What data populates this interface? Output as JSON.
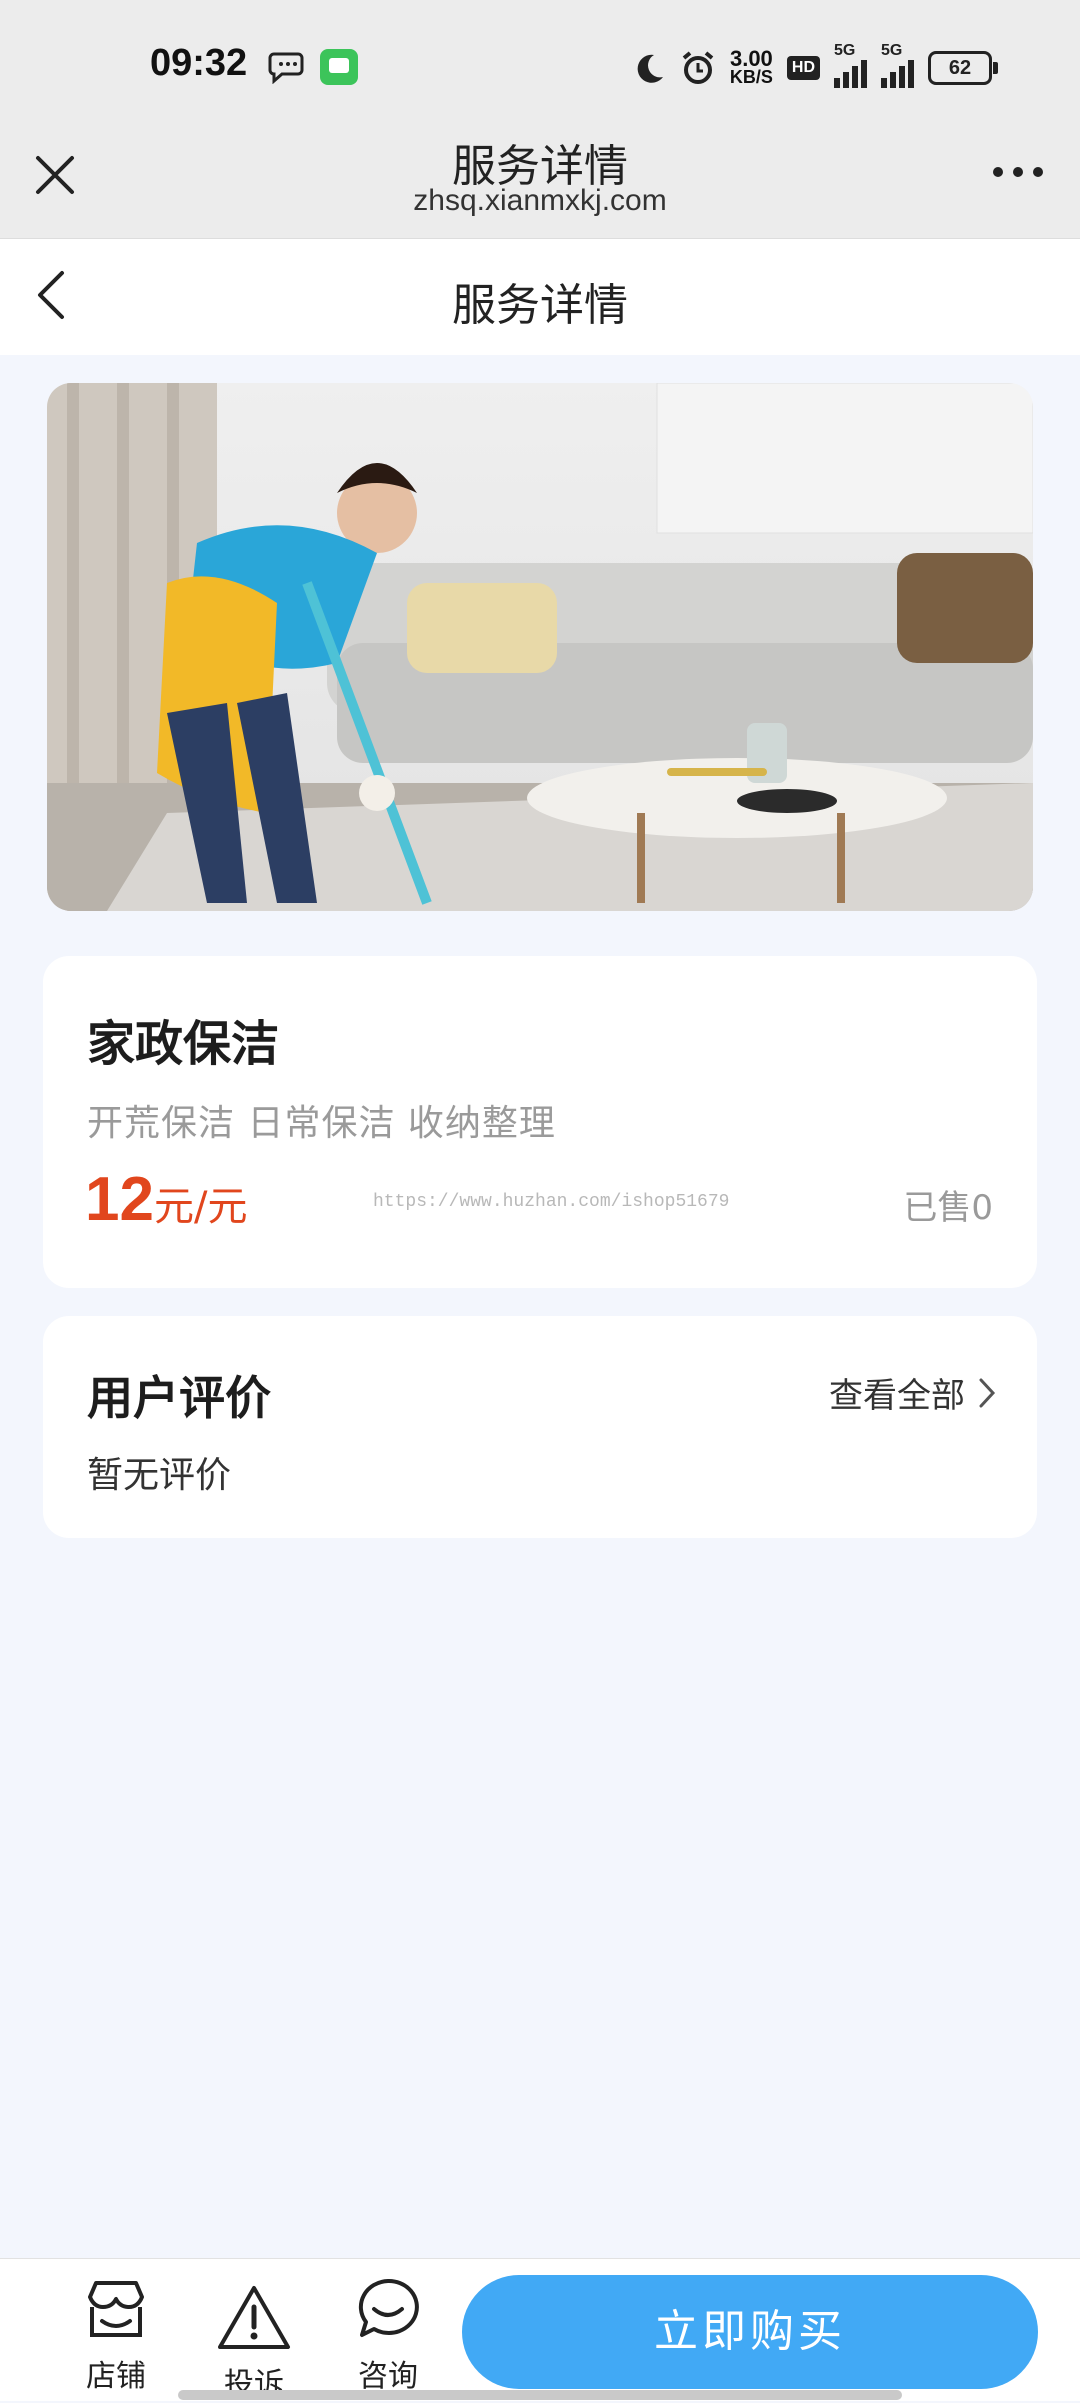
{
  "status_bar": {
    "time": "09:32",
    "net_speed_value": "3.00",
    "net_speed_unit": "KB/S",
    "hd_label": "HD",
    "sim1_label": "5G",
    "sim2_label": "5G",
    "battery": "62"
  },
  "browser": {
    "title": "服务详情",
    "url": "zhsq.xianmxkj.com"
  },
  "page": {
    "title": "服务详情"
  },
  "service": {
    "name": "家政保洁",
    "tags": "开荒保洁 日常保洁 收纳整理",
    "price": "12",
    "price_unit": "元/元",
    "sold": "已售0",
    "watermark": "https://www.huzhan.com/ishop51679"
  },
  "reviews": {
    "title": "用户评价",
    "view_all": "查看全部",
    "empty_text": "暂无评价"
  },
  "bottom_bar": {
    "tabs": [
      {
        "label": "店铺",
        "icon": "store-icon"
      },
      {
        "label": "投诉",
        "icon": "warning-icon"
      },
      {
        "label": "咨询",
        "icon": "chat-icon"
      }
    ],
    "buy_label": "立即购买"
  },
  "colors": {
    "price": "#e1461d",
    "buy_button": "#41a9f5",
    "page_bg": "#f3f6fd"
  }
}
